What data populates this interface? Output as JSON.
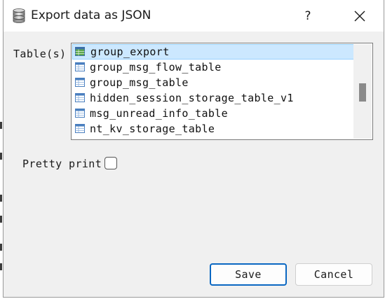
{
  "window": {
    "title": "Export data as JSON",
    "help_glyph": "?",
    "close_glyph": "close-icon",
    "app_icon": "database-icon"
  },
  "form": {
    "tables_label": "Table(s)",
    "tables": [
      {
        "label": "group_export",
        "selected": true
      },
      {
        "label": "group_msg_flow_table",
        "selected": false
      },
      {
        "label": "group_msg_table",
        "selected": false
      },
      {
        "label": "hidden_session_storage_table_v1",
        "selected": false
      },
      {
        "label": "msg_unread_info_table",
        "selected": false
      },
      {
        "label": "nt_kv_storage_table",
        "selected": false
      }
    ],
    "pretty_print_label": "Pretty print",
    "pretty_print_checked": false
  },
  "buttons": {
    "save_label": "Save",
    "cancel_label": "Cancel"
  },
  "colors": {
    "accent": "#0a67c2",
    "selection_bg": "#cce8ff",
    "selection_border": "#99d1ff",
    "dialog_bg": "#f0f0f0"
  }
}
